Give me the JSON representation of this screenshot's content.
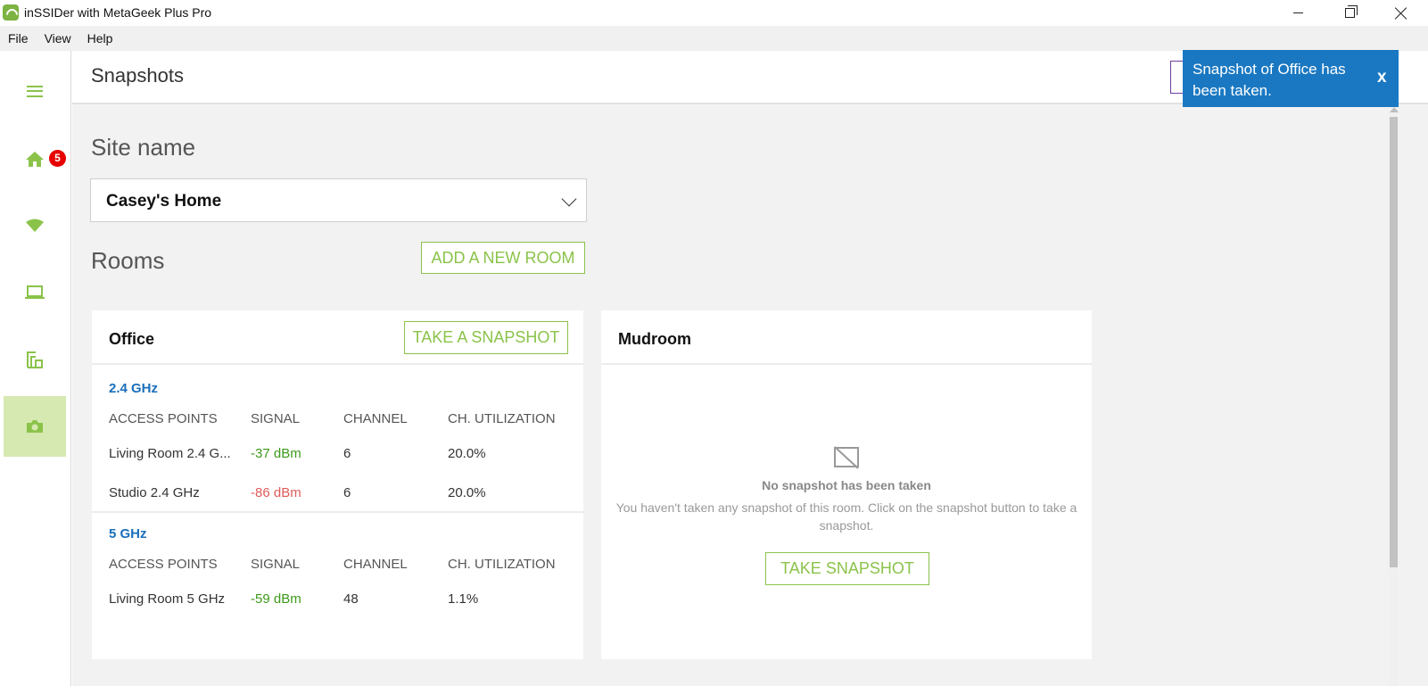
{
  "window": {
    "title": "inSSIDer with MetaGeek Plus Pro"
  },
  "menu": [
    "File",
    "View",
    "Help"
  ],
  "sidebar": {
    "items": [
      {
        "icon": "menu-icon"
      },
      {
        "icon": "home-icon",
        "badge": "5"
      },
      {
        "icon": "wifi-icon"
      },
      {
        "icon": "laptop-icon"
      },
      {
        "icon": "floorplan-icon"
      },
      {
        "icon": "camera-icon",
        "active": true
      }
    ],
    "accent": "#8bc34a"
  },
  "page": {
    "title": "Snapshots"
  },
  "site": {
    "label": "Site name",
    "selected": "Casey's Home"
  },
  "rooms": {
    "label": "Rooms",
    "add_button": "ADD A NEW ROOM",
    "office": {
      "name": "Office",
      "snapshot_button": "TAKE A SNAPSHOT",
      "headers": [
        "ACCESS POINTS",
        "SIGNAL",
        "CHANNEL",
        "CH. UTILIZATION"
      ],
      "bands": [
        {
          "label": "2.4 GHz",
          "rows": [
            {
              "ap": "Living Room 2.4 G...",
              "signal": "-37 dBm",
              "channel": "6",
              "util": "20.0%"
            },
            {
              "ap": "Studio 2.4 GHz",
              "signal": "-86 dBm",
              "channel": "6",
              "util": "20.0%"
            }
          ]
        },
        {
          "label": "5 GHz",
          "rows": [
            {
              "ap": "Living Room 5 GHz",
              "signal": "-59 dBm",
              "channel": "48",
              "util": "1.1%"
            }
          ]
        }
      ]
    },
    "mudroom": {
      "name": "Mudroom",
      "empty_title": "No snapshot has been taken",
      "empty_desc": "You haven't taken any snapshot of this room. Click on the snapshot button to take a snapshot.",
      "snapshot_button": "TAKE SNAPSHOT"
    }
  },
  "toast": {
    "message": "Snapshot of Office has been taken.",
    "close": "x",
    "color": "#1a78c2"
  }
}
